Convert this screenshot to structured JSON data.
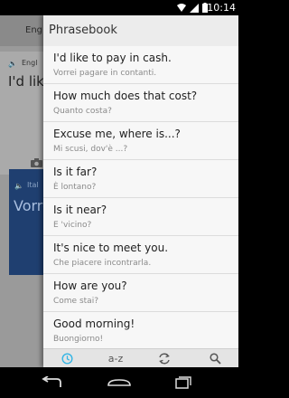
{
  "status_bar": {
    "time": "10:14",
    "icons": [
      "wifi-icon",
      "signal-icon",
      "battery-icon"
    ]
  },
  "background_app": {
    "header_lang": "Eng",
    "source_lang": "Engl",
    "source_text": "I'd like",
    "target_lang": "Ital",
    "target_text": "Vorre"
  },
  "drawer": {
    "title": "Phrasebook",
    "phrases": [
      {
        "text": "I'd like to pay in cash.",
        "translation": "Vorrei pagare in contanti."
      },
      {
        "text": "How much does that cost?",
        "translation": "Quanto costa?"
      },
      {
        "text": "Excuse me, where is...?",
        "translation": "Mi scusi, dov'è ...?"
      },
      {
        "text": "Is it far?",
        "translation": "È lontano?"
      },
      {
        "text": "Is it near?",
        "translation": "E 'vicino?"
      },
      {
        "text": "It's nice to meet you.",
        "translation": "Che piacere incontrarla."
      },
      {
        "text": "How are you?",
        "translation": "Come stai?"
      },
      {
        "text": "Good morning!",
        "translation": "Buongiorno!"
      }
    ],
    "tabs": {
      "recent": "recent-clock-icon",
      "az_label": "a-z",
      "sync": "sync-icon",
      "search": "search-icon"
    },
    "accent_color": "#33b5e5"
  }
}
